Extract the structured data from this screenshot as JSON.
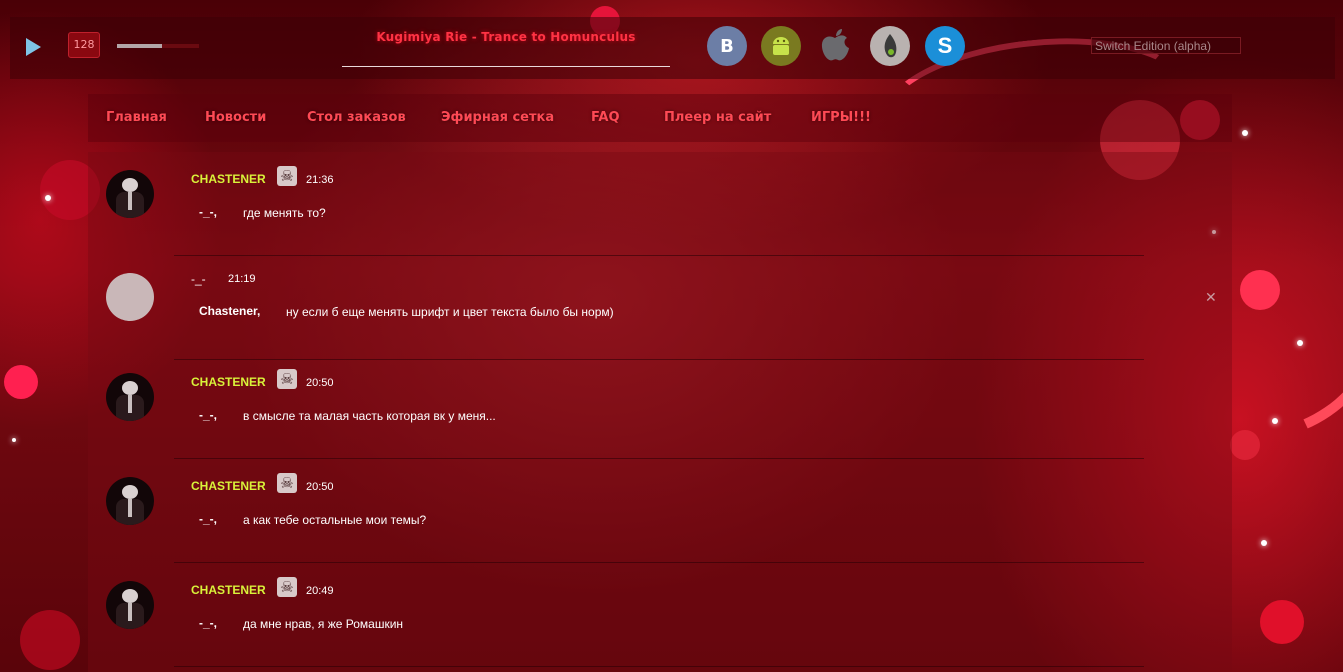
{
  "player": {
    "bitrate": "128",
    "volume_fraction": 0.55,
    "track_title": "Kugimiya Rie - Trance to Homunculus"
  },
  "social": {
    "vk_letter": "B",
    "skype_letter": "S",
    "icons": [
      "vk-icon",
      "android-icon",
      "apple-icon",
      "winamp-icon",
      "skype-icon"
    ]
  },
  "switch_edition": {
    "label": "Switch Edition (alpha)"
  },
  "nav": {
    "items": [
      {
        "label": "Главная"
      },
      {
        "label": "Новости"
      },
      {
        "label": "Стол заказов"
      },
      {
        "label": "Эфирная сетка"
      },
      {
        "label": "FAQ"
      },
      {
        "label": "Плеер на сайт"
      },
      {
        "label": "ИГРЫ!!!"
      }
    ]
  },
  "messages": [
    {
      "author": "CHASTENER",
      "time": "21:36",
      "reply_to": "-_-,",
      "text": "где менять то?"
    },
    {
      "author": "-_-",
      "time": "21:19",
      "reply_to": "Chastener,",
      "text": "ну если б еще менять шрифт и цвет текста было бы норм)"
    },
    {
      "author": "CHASTENER",
      "time": "20:50",
      "reply_to": "-_-,",
      "text": "в смысле та малая часть которая вк у меня..."
    },
    {
      "author": "CHASTENER",
      "time": "20:50",
      "reply_to": "-_-,",
      "text": "а как тебе остальные мои темы?"
    },
    {
      "author": "CHASTENER",
      "time": "20:49",
      "reply_to": "-_-,",
      "text": "да мне нрав, я же Ромашкин"
    }
  ],
  "colors": {
    "accent": "#ff3344",
    "author_highlight": "#d9f23a",
    "background": "#5a040a"
  }
}
